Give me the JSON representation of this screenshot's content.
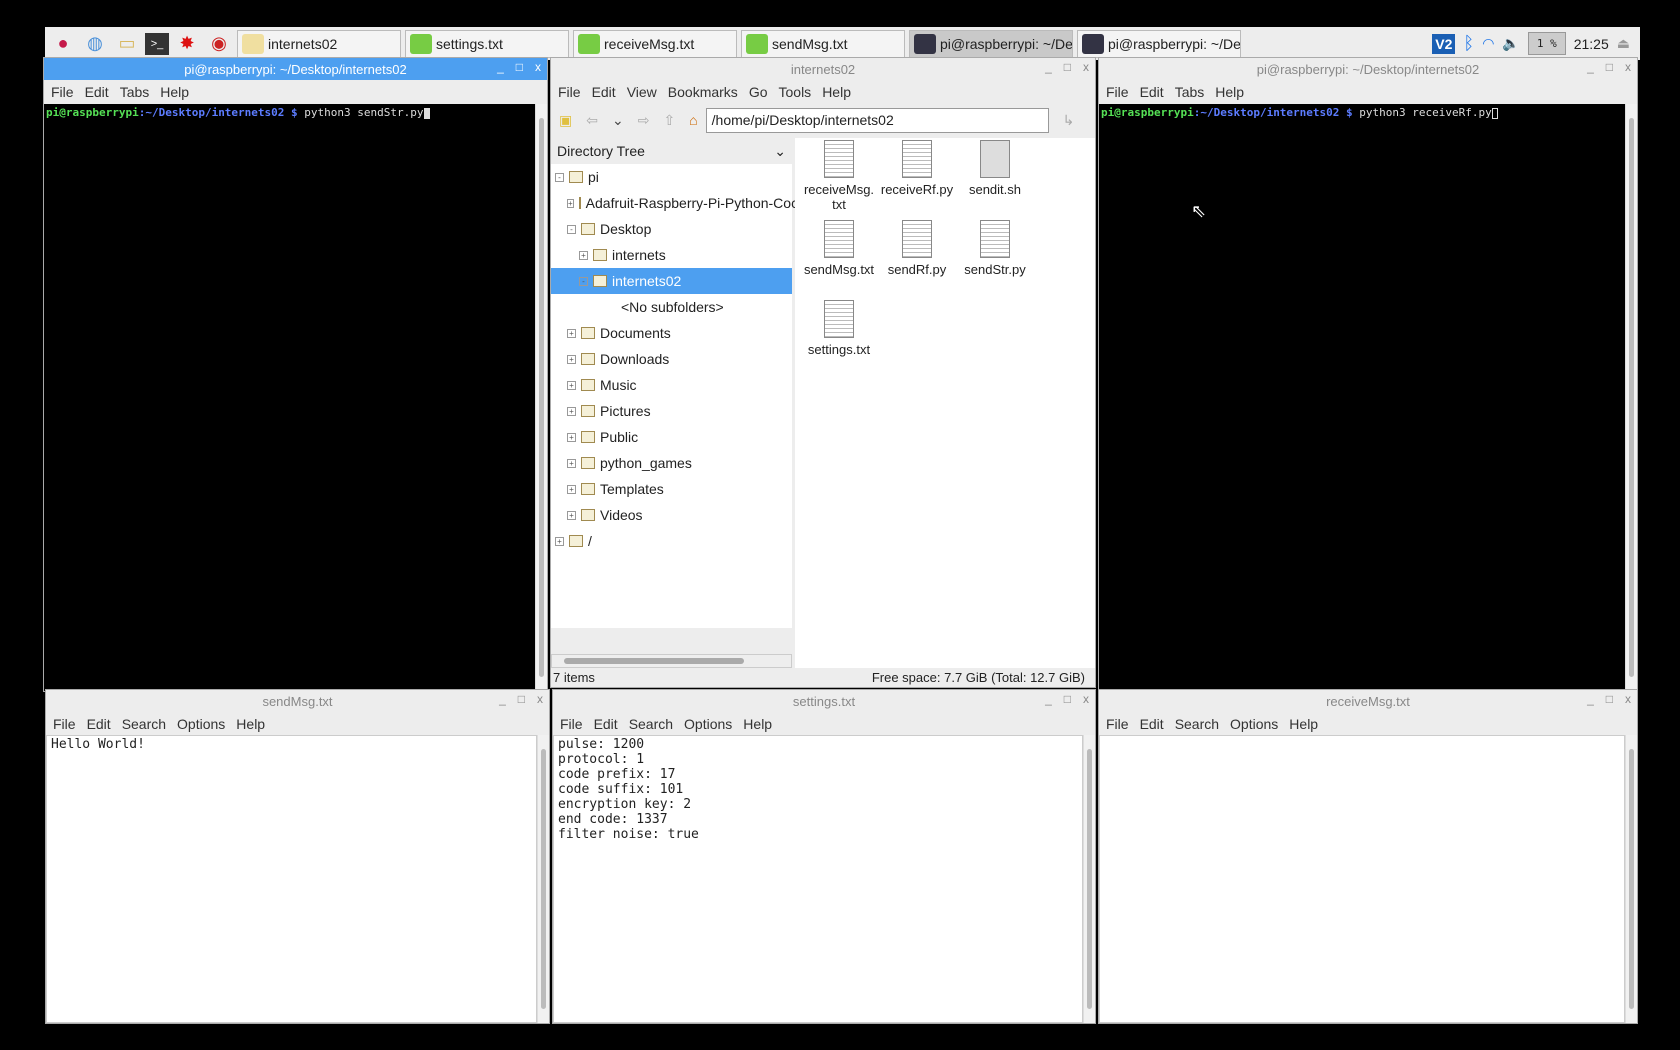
{
  "taskbar": {
    "tasks": [
      {
        "label": "internets02",
        "icon": "folder-icon"
      },
      {
        "label": "settings.txt",
        "icon": "text-editor-icon"
      },
      {
        "label": "receiveMsg.txt",
        "icon": "text-editor-icon"
      },
      {
        "label": "sendMsg.txt",
        "icon": "text-editor-icon"
      },
      {
        "label": "pi@raspberrypi: ~/De...",
        "icon": "terminal-icon"
      },
      {
        "label": "pi@raspberrypi: ~/De...",
        "icon": "terminal-icon"
      }
    ],
    "vnc": "V2",
    "cpu": "1 %",
    "clock": "21:25"
  },
  "term_left": {
    "title": "pi@raspberrypi: ~/Desktop/internets02",
    "menu": [
      "File",
      "Edit",
      "Tabs",
      "Help"
    ],
    "user": "pi@raspberrypi",
    "path": ":~/Desktop/internets02 $",
    "cmd": " python3 sendStr.py"
  },
  "term_right": {
    "title": "pi@raspberrypi: ~/Desktop/internets02",
    "menu": [
      "File",
      "Edit",
      "Tabs",
      "Help"
    ],
    "user": "pi@raspberrypi",
    "path": ":~/Desktop/internets02 $",
    "cmd": " python3 receiveRf.py"
  },
  "fm": {
    "title": "internets02",
    "menu": [
      "File",
      "Edit",
      "View",
      "Bookmarks",
      "Go",
      "Tools",
      "Help"
    ],
    "address": "/home/pi/Desktop/internets02",
    "pane": "Directory Tree",
    "tree": [
      "pi",
      "Adafruit-Raspberry-Pi-Python-Coc",
      "Desktop",
      "internets",
      "internets02",
      "<No subfolders>",
      "Documents",
      "Downloads",
      "Music",
      "Pictures",
      "Public",
      "python_games",
      "Templates",
      "Videos",
      "/"
    ],
    "files": [
      "receiveMsg.\ntxt",
      "receiveRf.py",
      "sendit.sh",
      "sendMsg.txt",
      "sendRf.py",
      "sendStr.py",
      "settings.txt"
    ],
    "status_items": "7 items",
    "status_space": "Free space: 7.7 GiB (Total: 12.7 GiB)"
  },
  "ed_send": {
    "title": "sendMsg.txt",
    "menu": [
      "File",
      "Edit",
      "Search",
      "Options",
      "Help"
    ],
    "content": "Hello World!"
  },
  "ed_settings": {
    "title": "settings.txt",
    "menu": [
      "File",
      "Edit",
      "Search",
      "Options",
      "Help"
    ],
    "content": "pulse: 1200\nprotocol: 1\ncode prefix: 17\ncode suffix: 101\nencryption key: 2\nend code: 1337\nfilter noise: true"
  },
  "ed_recv": {
    "title": "receiveMsg.txt",
    "menu": [
      "File",
      "Edit",
      "Search",
      "Options",
      "Help"
    ],
    "content": ""
  }
}
